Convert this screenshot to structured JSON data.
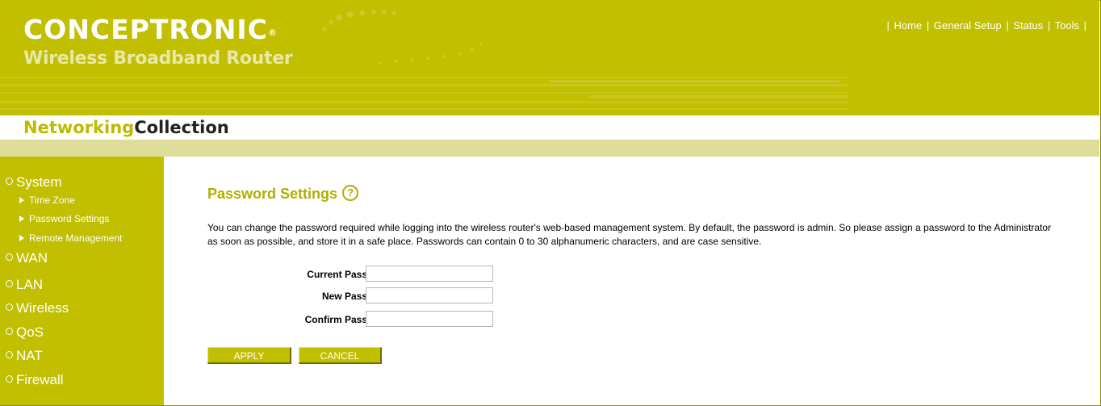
{
  "header": {
    "brand": "CONCEPTRONIC",
    "brand_reg": "®",
    "product": "Wireless Broadband Router",
    "collection_part1": "Networking",
    "collection_part2": "Collection"
  },
  "topnav": {
    "items": [
      "Home",
      "General Setup",
      "Status",
      "Tools"
    ]
  },
  "sidebar": {
    "main_items": [
      "System",
      "WAN",
      "LAN",
      "Wireless",
      "QoS",
      "NAT",
      "Firewall"
    ],
    "system_sub_items": [
      "Time Zone",
      "Password Settings",
      "Remote Management"
    ]
  },
  "page": {
    "title": "Password Settings",
    "help_icon": "help-circle-icon",
    "description": "You can change the password required while logging into the wireless router's web-based management system. By default, the password is admin. So please assign a password to the Administrator as soon as possible, and store it in a safe place. Passwords can contain 0 to 30 alphanumeric characters, and are case sensitive.",
    "fields": [
      {
        "label": "Current Password :",
        "value": ""
      },
      {
        "label": "New Password :",
        "value": ""
      },
      {
        "label": "Confirm Password :",
        "value": ""
      }
    ],
    "apply_label": "APPLY",
    "cancel_label": "CANCEL"
  },
  "colors": {
    "accent": "#c1bf00",
    "title": "#b0ae00",
    "stripe": "#dedc99"
  }
}
